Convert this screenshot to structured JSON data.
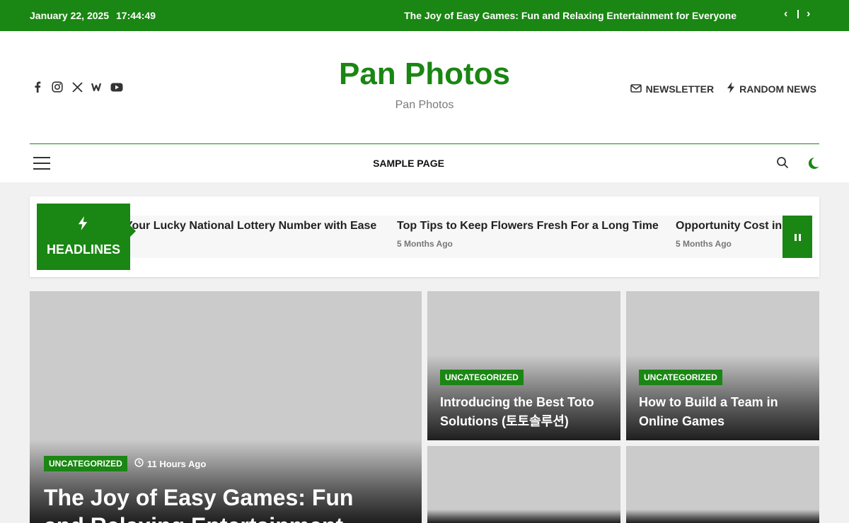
{
  "topbar": {
    "date": "January 22, 2025",
    "time": "17:44:49",
    "ticker": "The Joy of Easy Games: Fun and Relaxing Entertainment for Everyone",
    "prev_label": "‹",
    "next_label": "›"
  },
  "header": {
    "site_title": "Pan Photos",
    "tagline": "Pan Photos",
    "social": [
      "facebook-icon",
      "instagram-icon",
      "x-icon",
      "wn-icon",
      "youtube-icon"
    ],
    "newsletter_label": "NEWSLETTER",
    "random_label": "RANDOM NEWS"
  },
  "nav": {
    "items": [
      {
        "label": "SAMPLE PAGE"
      }
    ]
  },
  "headlines": {
    "label": "HEADLINES",
    "items": [
      {
        "title": "Your Lucky National Lottery Number with Ease",
        "date": ""
      },
      {
        "title": "Top Tips to Keep Flowers Fresh For a Long Time",
        "date": "5 Months Ago"
      },
      {
        "title": "Opportunity Cost in Trading",
        "date": "5 Months Ago"
      }
    ]
  },
  "posts": {
    "featured": {
      "category": "UNCATEGORIZED",
      "time": "11 Hours Ago",
      "title": "The Joy of Easy Games: Fun and Relaxing Entertainment"
    },
    "grid": [
      {
        "category": "UNCATEGORIZED",
        "title": "Introducing the Best Toto Solutions (토토솔루션)"
      },
      {
        "category": "UNCATEGORIZED",
        "title": "How to Build a Team in Online Games"
      }
    ]
  },
  "colors": {
    "brand_green": "#1a8613"
  }
}
